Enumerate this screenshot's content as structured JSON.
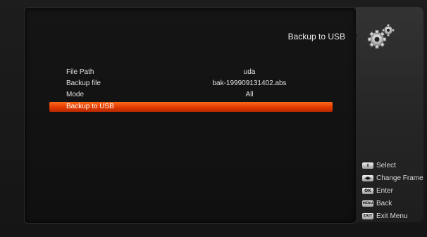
{
  "header": {
    "title": "Backup to USB"
  },
  "form": {
    "rows": [
      {
        "label": "File Path",
        "value": "uda"
      },
      {
        "label": "Backup file",
        "value": "bak-199909131402.abs"
      },
      {
        "label": "Mode",
        "value": "All"
      }
    ],
    "selected_row": {
      "label": "Backup to USB"
    }
  },
  "sidebar": {
    "icon": "gears-icon",
    "keys": [
      {
        "icon": "updown-arrows-icon",
        "badge": "⇕",
        "label": "Select"
      },
      {
        "icon": "leftright-arrows-icon",
        "badge": "◀▶",
        "label": "Change Frame"
      },
      {
        "icon": "ok-key-icon",
        "badge": "OK",
        "label": "Enter"
      },
      {
        "icon": "menu-key-icon",
        "badge": "MENU",
        "label": "Back"
      },
      {
        "icon": "exit-key-icon",
        "badge": "EXIT",
        "label": "Exit Menu"
      }
    ]
  },
  "colors": {
    "accent": "#e84a0c",
    "panel": "#141414",
    "text": "#e0e0e0"
  }
}
